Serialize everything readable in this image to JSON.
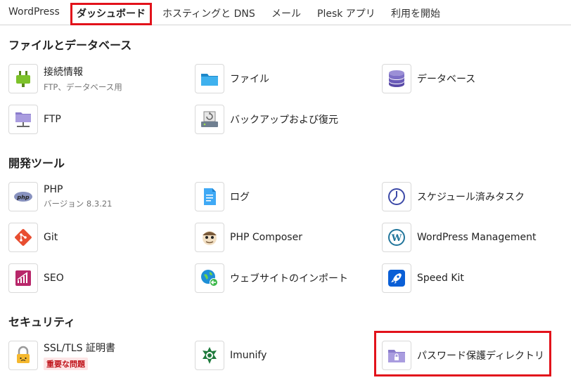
{
  "tabs": [
    {
      "label": "WordPress"
    },
    {
      "label": "ダッシュボード"
    },
    {
      "label": "ホスティングと DNS"
    },
    {
      "label": "メール"
    },
    {
      "label": "Plesk アプリ"
    },
    {
      "label": "利用を開始"
    }
  ],
  "active_tab": "ダッシュボード",
  "sections": {
    "files": {
      "title": "ファイルとデータベース",
      "items": [
        {
          "label": "接続情報",
          "sub": "FTP、データベース用",
          "icon": "plug-icon"
        },
        {
          "label": "ファイル",
          "icon": "folder-icon"
        },
        {
          "label": "データベース",
          "icon": "database-icon"
        },
        {
          "label": "FTP",
          "icon": "ftp-folder-icon"
        },
        {
          "label": "バックアップおよび復元",
          "icon": "backup-icon"
        }
      ]
    },
    "dev": {
      "title": "開発ツール",
      "items": [
        {
          "label": "PHP",
          "sub": "バージョン 8.3.21",
          "icon": "php-icon"
        },
        {
          "label": "ログ",
          "icon": "log-icon"
        },
        {
          "label": "スケジュール済みタスク",
          "icon": "clock-icon"
        },
        {
          "label": "Git",
          "icon": "git-icon"
        },
        {
          "label": "PHP Composer",
          "icon": "composer-icon"
        },
        {
          "label": "WordPress Management",
          "icon": "wordpress-icon"
        },
        {
          "label": "SEO",
          "icon": "seo-icon"
        },
        {
          "label": "ウェブサイトのインポート",
          "icon": "import-icon"
        },
        {
          "label": "Speed Kit",
          "icon": "rocket-icon"
        }
      ]
    },
    "security": {
      "title": "セキュリティ",
      "items": [
        {
          "label": "SSL/TLS 証明書",
          "badge": "重要な問題",
          "icon": "lock-icon"
        },
        {
          "label": "Imunify",
          "icon": "imunify-icon"
        },
        {
          "label": "パスワード保護ディレクトリ",
          "icon": "protected-folder-icon"
        }
      ]
    }
  },
  "colors": {
    "accent_blue": "#28aade",
    "highlight_red": "#e2121b",
    "badge_red": "#c0141b"
  }
}
